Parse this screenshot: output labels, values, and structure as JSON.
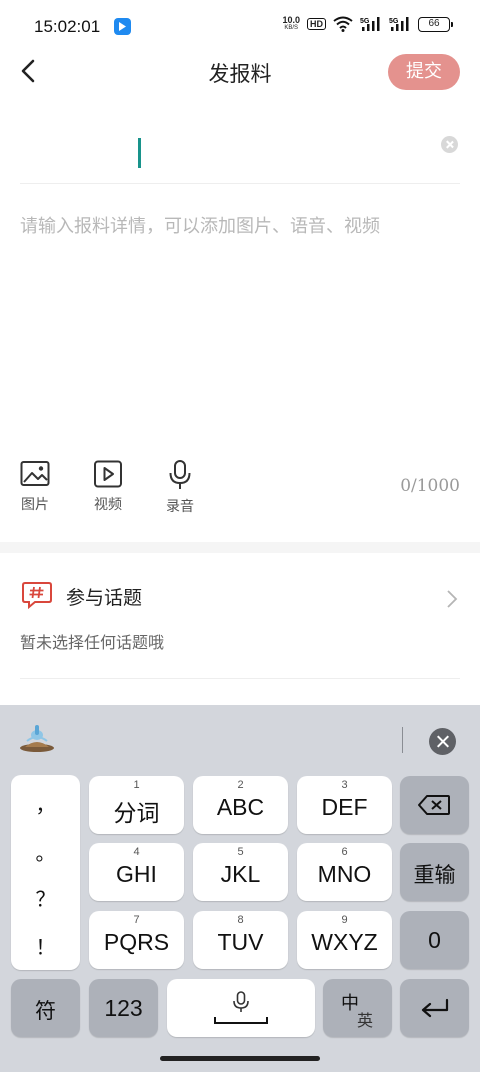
{
  "status_bar": {
    "time": "15:02:01",
    "net_speed_value": "10.0",
    "net_speed_unit": "KB/S",
    "hd_label": "HD",
    "battery": "66"
  },
  "header": {
    "title": "发报料",
    "submit_label": "提交"
  },
  "form": {
    "detail_placeholder": "请输入报料详情，可以添加图片、语音、视频",
    "counter": "0/1000"
  },
  "media_tools": [
    {
      "label": "图片",
      "icon": "image-icon"
    },
    {
      "label": "视频",
      "icon": "video-icon"
    },
    {
      "label": "录音",
      "icon": "microphone-icon"
    }
  ],
  "topic": {
    "label": "参与话题",
    "subtitle": "暂未选择任何话题哦"
  },
  "keyboard": {
    "punctuation": [
      "，",
      "。",
      "？",
      "！"
    ],
    "keys_row1": [
      {
        "num": "1",
        "label": "分词"
      },
      {
        "num": "2",
        "label": "ABC"
      },
      {
        "num": "3",
        "label": "DEF"
      }
    ],
    "keys_row2": [
      {
        "num": "4",
        "label": "GHI"
      },
      {
        "num": "5",
        "label": "JKL"
      },
      {
        "num": "6",
        "label": "MNO"
      }
    ],
    "keys_row3": [
      {
        "num": "7",
        "label": "PQRS"
      },
      {
        "num": "8",
        "label": "TUV"
      },
      {
        "num": "9",
        "label": "WXYZ"
      }
    ],
    "reenter_label": "重输",
    "zero_label": "0",
    "symbol_label": "符",
    "numeric_label": "123",
    "lang_cn": "中",
    "lang_en": "英"
  },
  "colors": {
    "accent": "#e4928e",
    "cursor": "#18938b",
    "topic_icon": "#d9473c",
    "keyboard_bg": "#d3d6dc"
  }
}
